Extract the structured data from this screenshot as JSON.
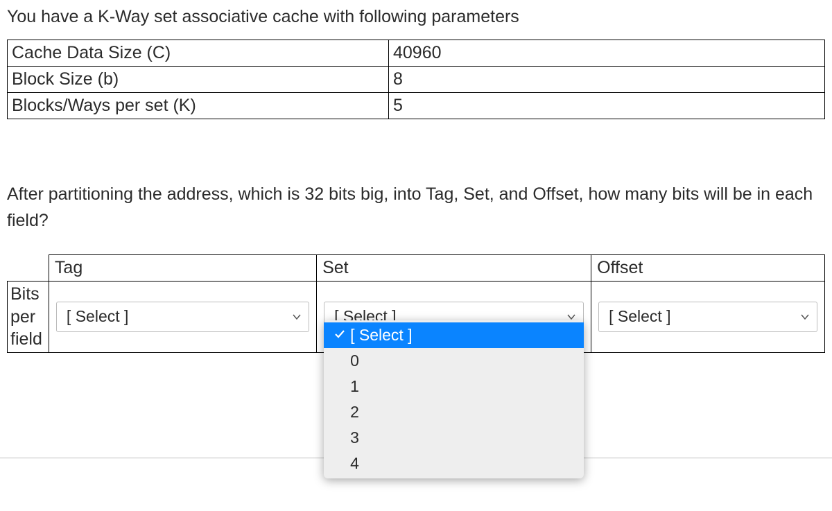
{
  "intro": "You have a K-Way set associative cache with following parameters",
  "params": {
    "rows": [
      {
        "label": "Cache Data Size (C)",
        "value": "40960"
      },
      {
        "label": "Block Size (b)",
        "value": "8"
      },
      {
        "label": "Blocks/Ways per set (K)",
        "value": "5"
      }
    ]
  },
  "question": "After partitioning the address, which is 32 bits big, into Tag, Set, and Offset, how many bits will be in each field?",
  "answer_table": {
    "columns": [
      "Tag",
      "Set",
      "Offset"
    ],
    "row_label": "Bits per field",
    "placeholder": "[ Select ]",
    "selects": {
      "tag": "[ Select ]",
      "set_selected": "[ Select ]",
      "offset": "[ Select ]"
    },
    "dropdown_options": [
      "[ Select ]",
      "0",
      "1",
      "2",
      "3",
      "4"
    ]
  }
}
